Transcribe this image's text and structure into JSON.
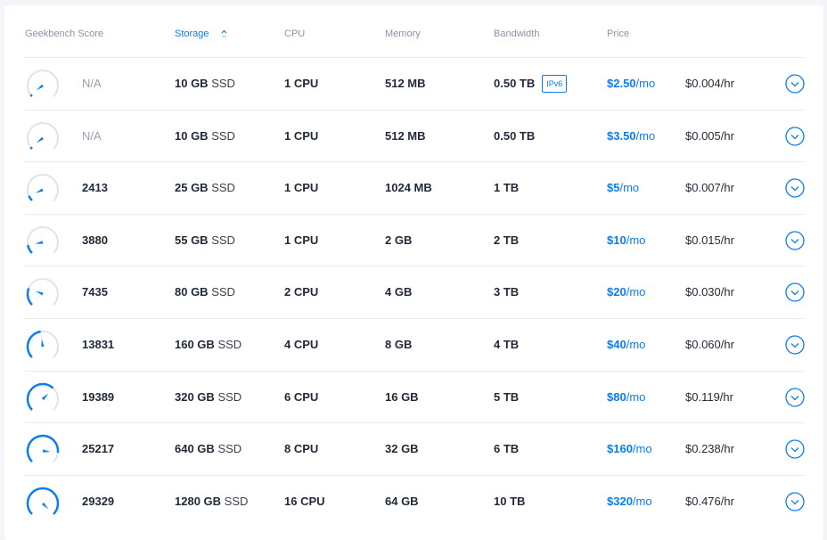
{
  "headers": {
    "geekbench": "Geekbench Score",
    "storage": "Storage",
    "cpu": "CPU",
    "memory": "Memory",
    "bandwidth": "Bandwidth",
    "price": "Price"
  },
  "colors": {
    "accent": "#0a7df2",
    "gauge_track": "#dfe3ea",
    "row_border": "#e8ebf0"
  },
  "plans": [
    {
      "score": "N/A",
      "score_muted": true,
      "gauge_level": 0.03,
      "storage_value": "10 GB",
      "storage_type": "SSD",
      "cpu": "1 CPU",
      "memory": "512 MB",
      "bandwidth": "0.50 TB",
      "tag": "IPv6",
      "price_amount": "$2.50",
      "price_unit": "/mo",
      "hourly": "$0.004/hr"
    },
    {
      "score": "N/A",
      "score_muted": true,
      "gauge_level": 0.03,
      "storage_value": "10 GB",
      "storage_type": "SSD",
      "cpu": "1 CPU",
      "memory": "512 MB",
      "bandwidth": "0.50 TB",
      "tag": "",
      "price_amount": "$3.50",
      "price_unit": "/mo",
      "hourly": "$0.005/hr"
    },
    {
      "score": "2413",
      "score_muted": false,
      "gauge_level": 0.08,
      "storage_value": "25 GB",
      "storage_type": "SSD",
      "cpu": "1 CPU",
      "memory": "1024 MB",
      "bandwidth": "1 TB",
      "tag": "",
      "price_amount": "$5",
      "price_unit": "/mo",
      "hourly": "$0.007/hr"
    },
    {
      "score": "3880",
      "score_muted": false,
      "gauge_level": 0.13,
      "storage_value": "55 GB",
      "storage_type": "SSD",
      "cpu": "1 CPU",
      "memory": "2 GB",
      "bandwidth": "2 TB",
      "tag": "",
      "price_amount": "$10",
      "price_unit": "/mo",
      "hourly": "$0.015/hr"
    },
    {
      "score": "7435",
      "score_muted": false,
      "gauge_level": 0.25,
      "storage_value": "80 GB",
      "storage_type": "SSD",
      "cpu": "2 CPU",
      "memory": "4 GB",
      "bandwidth": "3 TB",
      "tag": "",
      "price_amount": "$20",
      "price_unit": "/mo",
      "hourly": "$0.030/hr"
    },
    {
      "score": "13831",
      "score_muted": false,
      "gauge_level": 0.47,
      "storage_value": "160 GB",
      "storage_type": "SSD",
      "cpu": "4 CPU",
      "memory": "8 GB",
      "bandwidth": "4 TB",
      "tag": "",
      "price_amount": "$40",
      "price_unit": "/mo",
      "hourly": "$0.060/hr"
    },
    {
      "score": "19389",
      "score_muted": false,
      "gauge_level": 0.66,
      "storage_value": "320 GB",
      "storage_type": "SSD",
      "cpu": "6 CPU",
      "memory": "16 GB",
      "bandwidth": "5 TB",
      "tag": "",
      "price_amount": "$80",
      "price_unit": "/mo",
      "hourly": "$0.119/hr"
    },
    {
      "score": "25217",
      "score_muted": false,
      "gauge_level": 0.86,
      "storage_value": "640 GB",
      "storage_type": "SSD",
      "cpu": "8 CPU",
      "memory": "32 GB",
      "bandwidth": "6 TB",
      "tag": "",
      "price_amount": "$160",
      "price_unit": "/mo",
      "hourly": "$0.238/hr"
    },
    {
      "score": "29329",
      "score_muted": false,
      "gauge_level": 1.0,
      "storage_value": "1280 GB",
      "storage_type": "SSD",
      "cpu": "16 CPU",
      "memory": "64 GB",
      "bandwidth": "10 TB",
      "tag": "",
      "price_amount": "$320",
      "price_unit": "/mo",
      "hourly": "$0.476/hr"
    }
  ]
}
